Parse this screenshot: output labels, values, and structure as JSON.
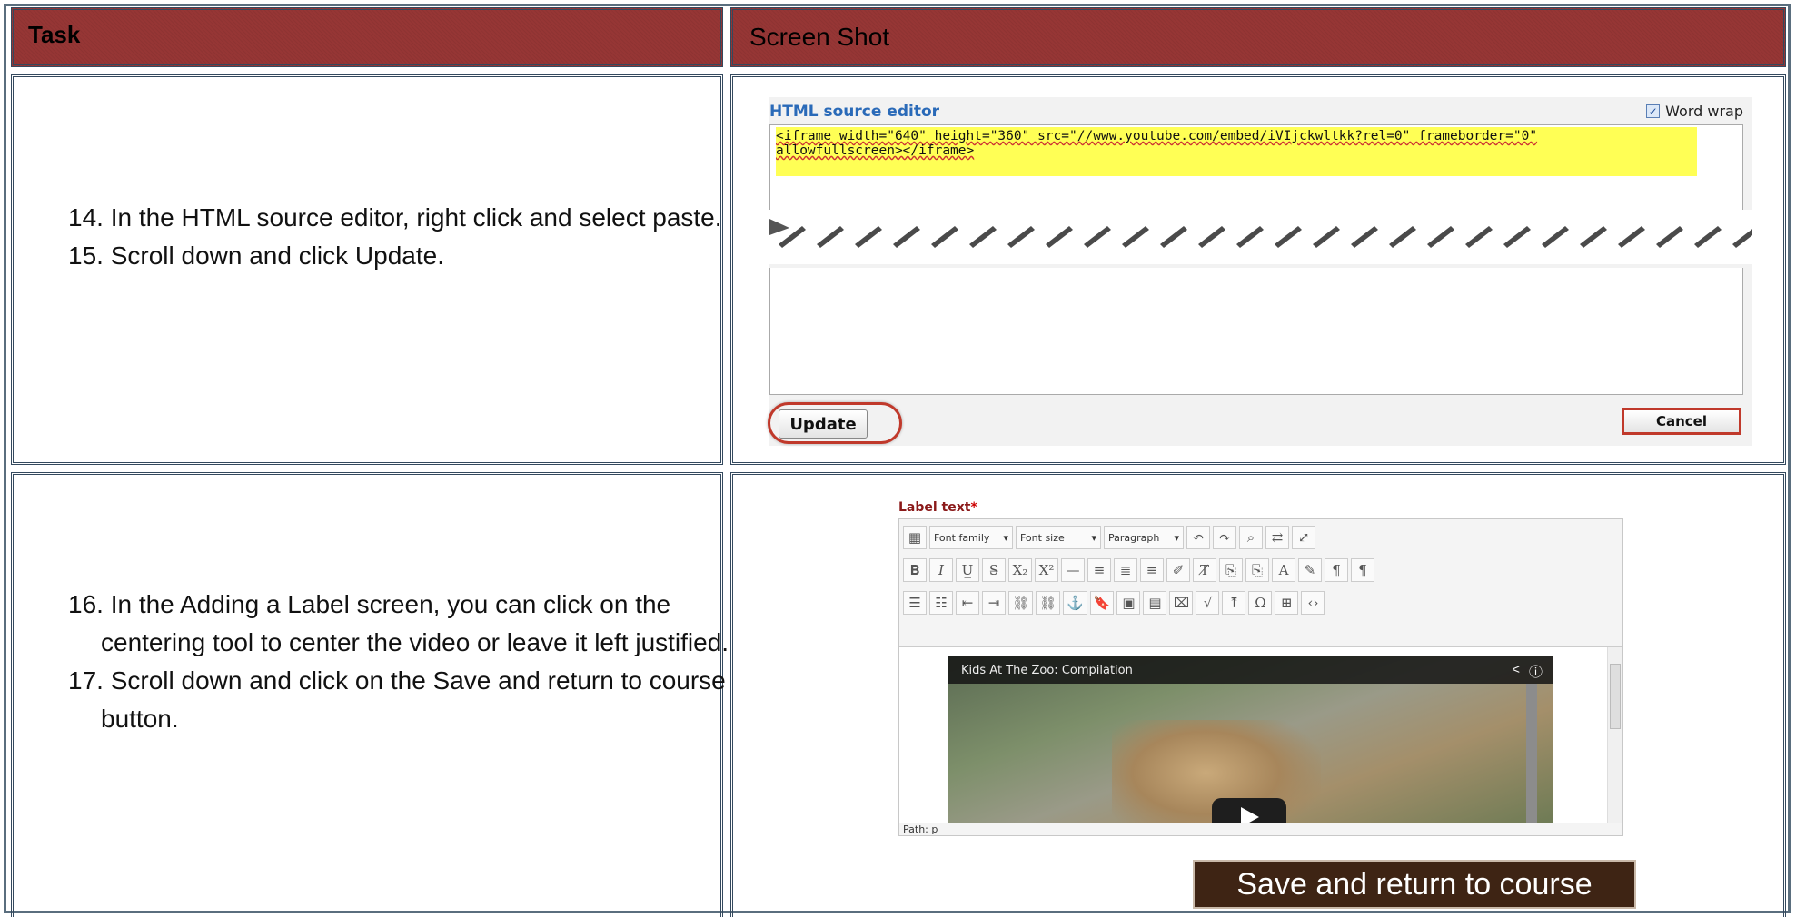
{
  "header": {
    "task": "Task",
    "screenshot": "Screen Shot"
  },
  "row1": {
    "steps": [
      "14. In the HTML source editor, right click and select paste.",
      "15. Scroll down and click Update."
    ],
    "source_editor": {
      "title": "HTML source editor",
      "word_wrap": "Word wrap",
      "code_line1": "<iframe width=\"640\" height=\"360\" src=\"//www.youtube.com/embed/iVIjckwltkk?rel=0\" frameborder=\"0\"",
      "code_line2": "allowfullscreen></iframe>",
      "update": "Update",
      "cancel": "Cancel"
    }
  },
  "row2": {
    "steps": [
      "16. In the Adding a Label screen, you can click on the centering tool to center the video or leave it left justified.",
      "17. Scroll down and click on the Save and return to course button."
    ],
    "label_editor": {
      "title": "Label text",
      "required_mark": "*",
      "font_family": "Font family",
      "font_size": "Font size",
      "paragraph": "Paragraph",
      "video_title": "Kids At The Zoo: Compilation",
      "path": "Path: p"
    },
    "save_button": "Save and return to course"
  },
  "colors": {
    "header_bg": "#963635",
    "highlight": "#ffff55",
    "ring": "#c0392b",
    "save_bg": "#3e2414"
  }
}
